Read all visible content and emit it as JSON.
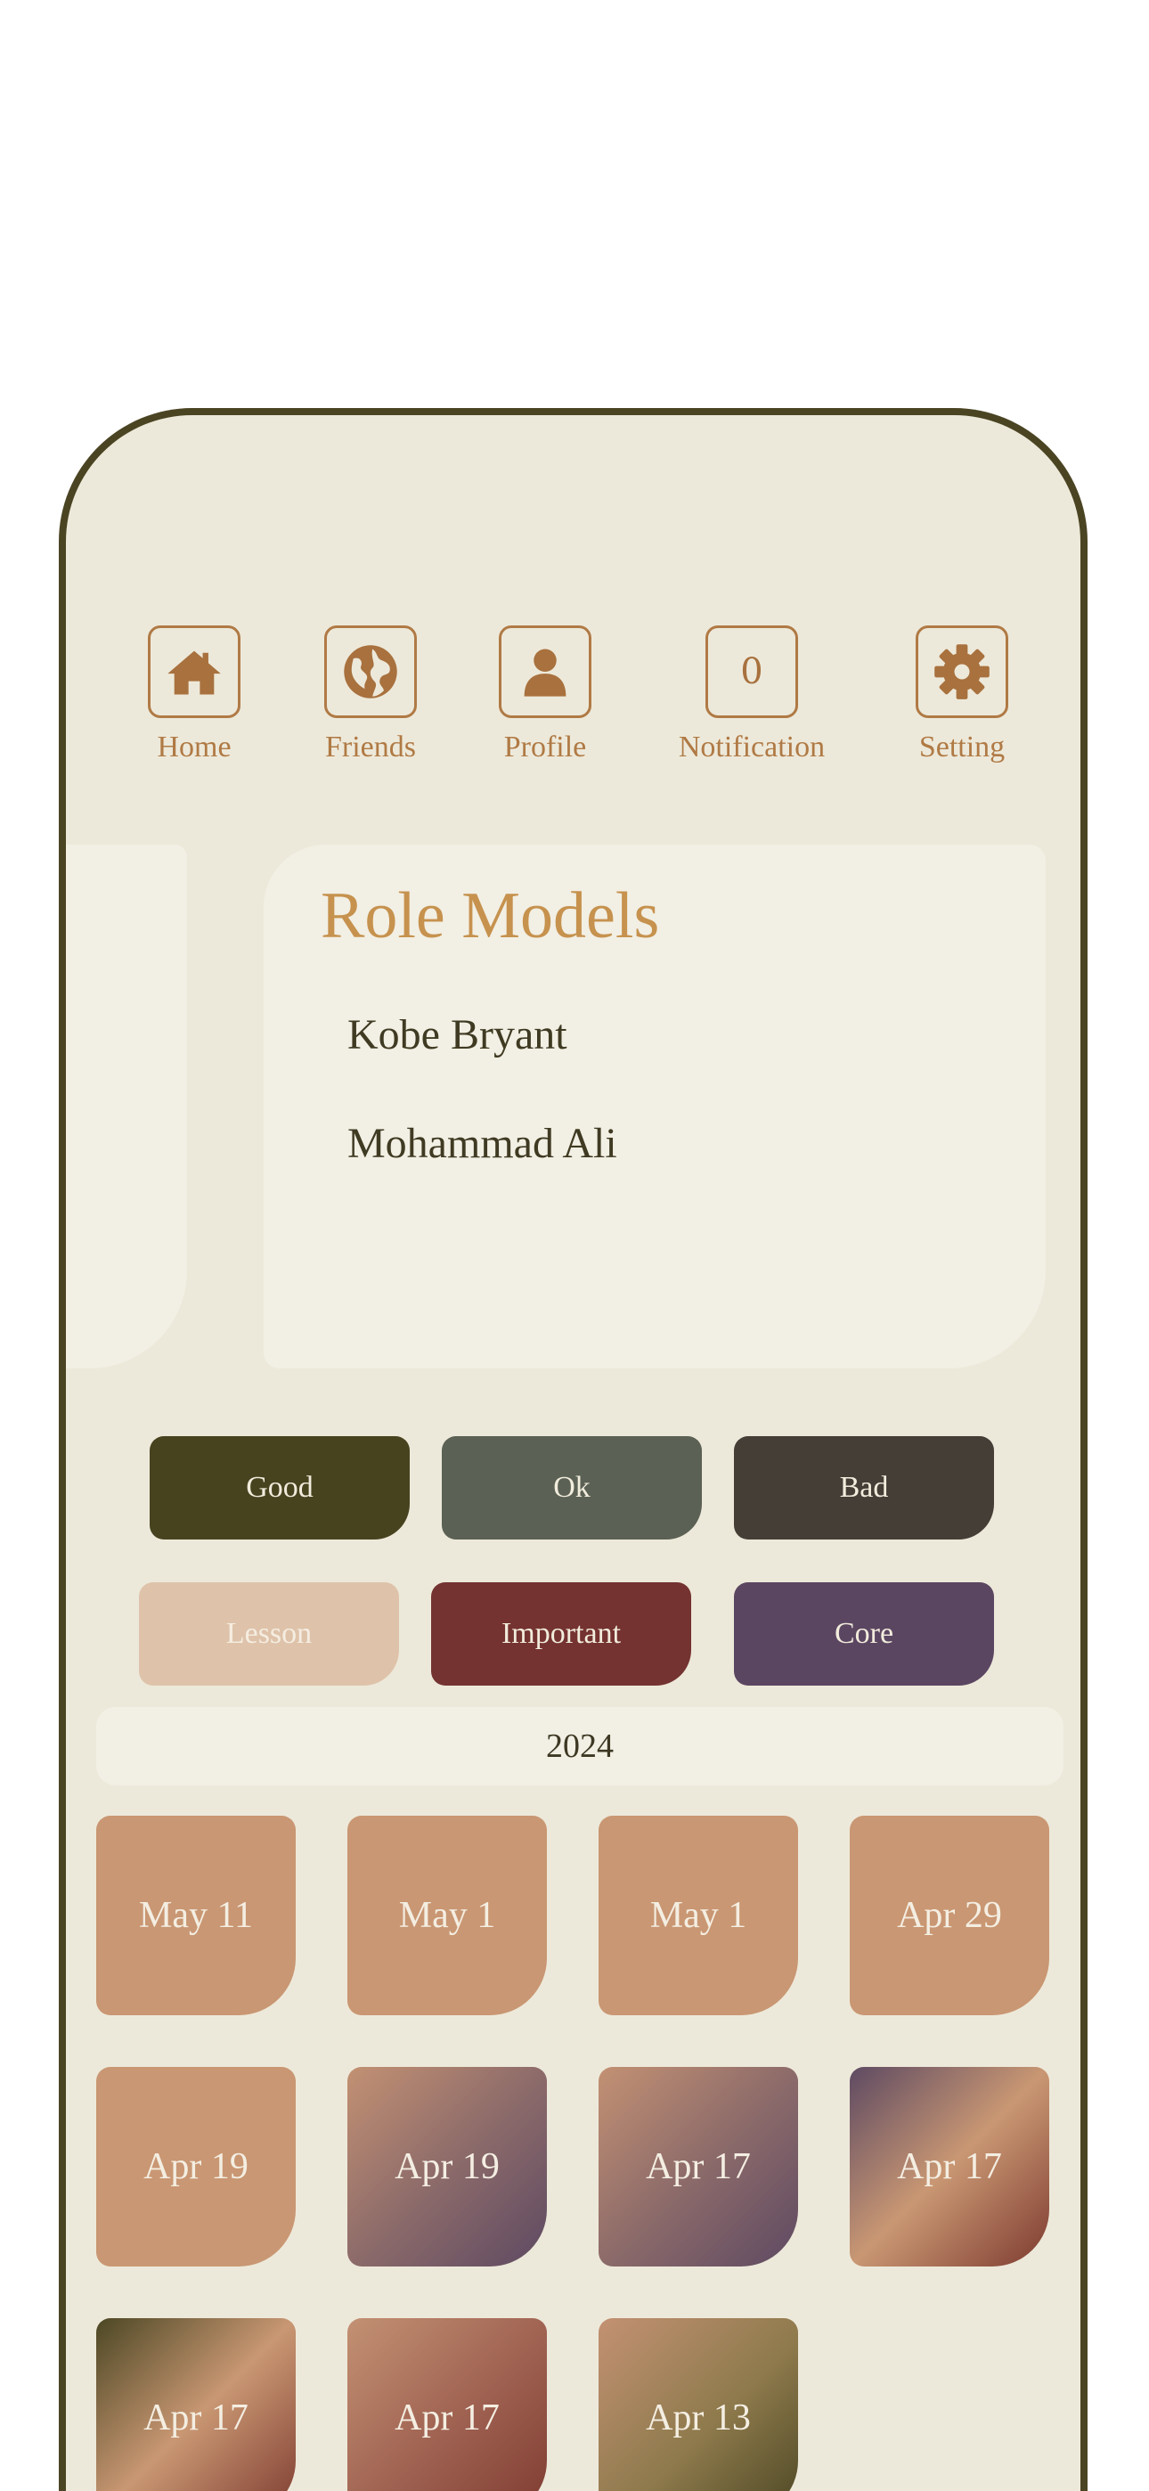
{
  "nav": [
    {
      "label": "Home",
      "icon": "home-icon"
    },
    {
      "label": "Friends",
      "icon": "globe-icon"
    },
    {
      "label": "Profile",
      "icon": "user-icon"
    },
    {
      "label": "Notification",
      "icon": "notification-count",
      "count": "0"
    },
    {
      "label": "Setting",
      "icon": "gear-icon"
    }
  ],
  "card": {
    "title": "Role Models",
    "items": [
      "Kobe Bryant",
      "Mohammad Ali"
    ]
  },
  "tags": [
    {
      "label": "Good",
      "bg": "#47431f",
      "fg": "#f1ecdc"
    },
    {
      "label": "Ok",
      "bg": "#5b6154",
      "fg": "#f1ecdc"
    },
    {
      "label": "Bad",
      "bg": "#453e37",
      "fg": "#f1ecdc"
    },
    {
      "label": "Lesson",
      "bg": "#dec3aa",
      "fg": "#f5ede1"
    },
    {
      "label": "Important",
      "bg": "#743330",
      "fg": "#f1ecdc"
    },
    {
      "label": "Core",
      "bg": "#5b4662",
      "fg": "#f1ecdc"
    }
  ],
  "year": "2024",
  "entries": [
    {
      "date": "May 11",
      "style": "solid"
    },
    {
      "date": "May 1",
      "style": "solid"
    },
    {
      "date": "May 1",
      "style": "solid"
    },
    {
      "date": "Apr 29",
      "style": "solid"
    },
    {
      "date": "Apr 19",
      "style": "solid"
    },
    {
      "date": "Apr 19",
      "style": "tan-purple"
    },
    {
      "date": "Apr 17",
      "style": "tan-purple"
    },
    {
      "date": "Apr 17",
      "style": "purple-tan-red"
    },
    {
      "date": "Apr 17",
      "style": "olive-tan-red"
    },
    {
      "date": "Apr 17",
      "style": "tan-red"
    },
    {
      "date": "Apr 13",
      "style": "tan-olive"
    }
  ],
  "colors": {
    "background": "#ede9da",
    "frame": "#4a4423",
    "accent": "#b07a45",
    "tile": "#c99773"
  }
}
